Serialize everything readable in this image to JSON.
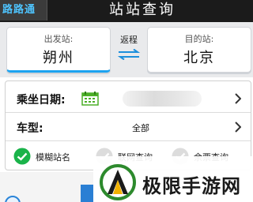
{
  "header": {
    "back_label": "路路通",
    "title": "站站查询"
  },
  "route": {
    "from_label": "出发站:",
    "from_station": "朔州",
    "swap_label": "返程",
    "to_label": "目的站:",
    "to_station": "北京"
  },
  "options": {
    "date_label": "乘坐日期:",
    "train_type_label": "车型:",
    "train_type_value": "全部"
  },
  "checks": [
    {
      "label": "模糊站名",
      "checked": true
    },
    {
      "label": "联网查询",
      "checked": false
    },
    {
      "label": "余票查询",
      "checked": false
    }
  ],
  "watermark": {
    "text": "极限手游网"
  },
  "colors": {
    "accent": "#1ca3f0",
    "check_green": "#1ab34a",
    "header_bg": "#1b1b1b"
  }
}
